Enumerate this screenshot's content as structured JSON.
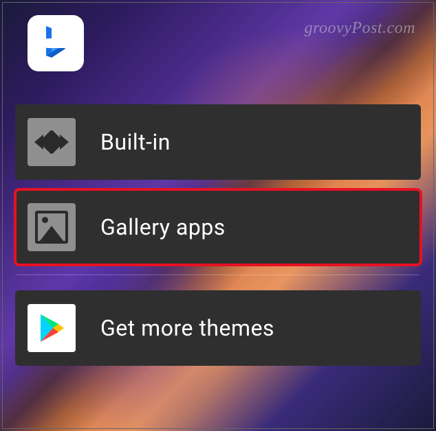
{
  "watermark": "groovyPost.com",
  "app_tile": {
    "name": "bing-app"
  },
  "menu": {
    "items": [
      {
        "label": "Built-in",
        "icon": "builtin-icon",
        "highlighted": false
      },
      {
        "label": "Gallery apps",
        "icon": "gallery-icon",
        "highlighted": true
      }
    ],
    "more": {
      "label": "Get more themes",
      "icon": "play-store-icon"
    }
  }
}
